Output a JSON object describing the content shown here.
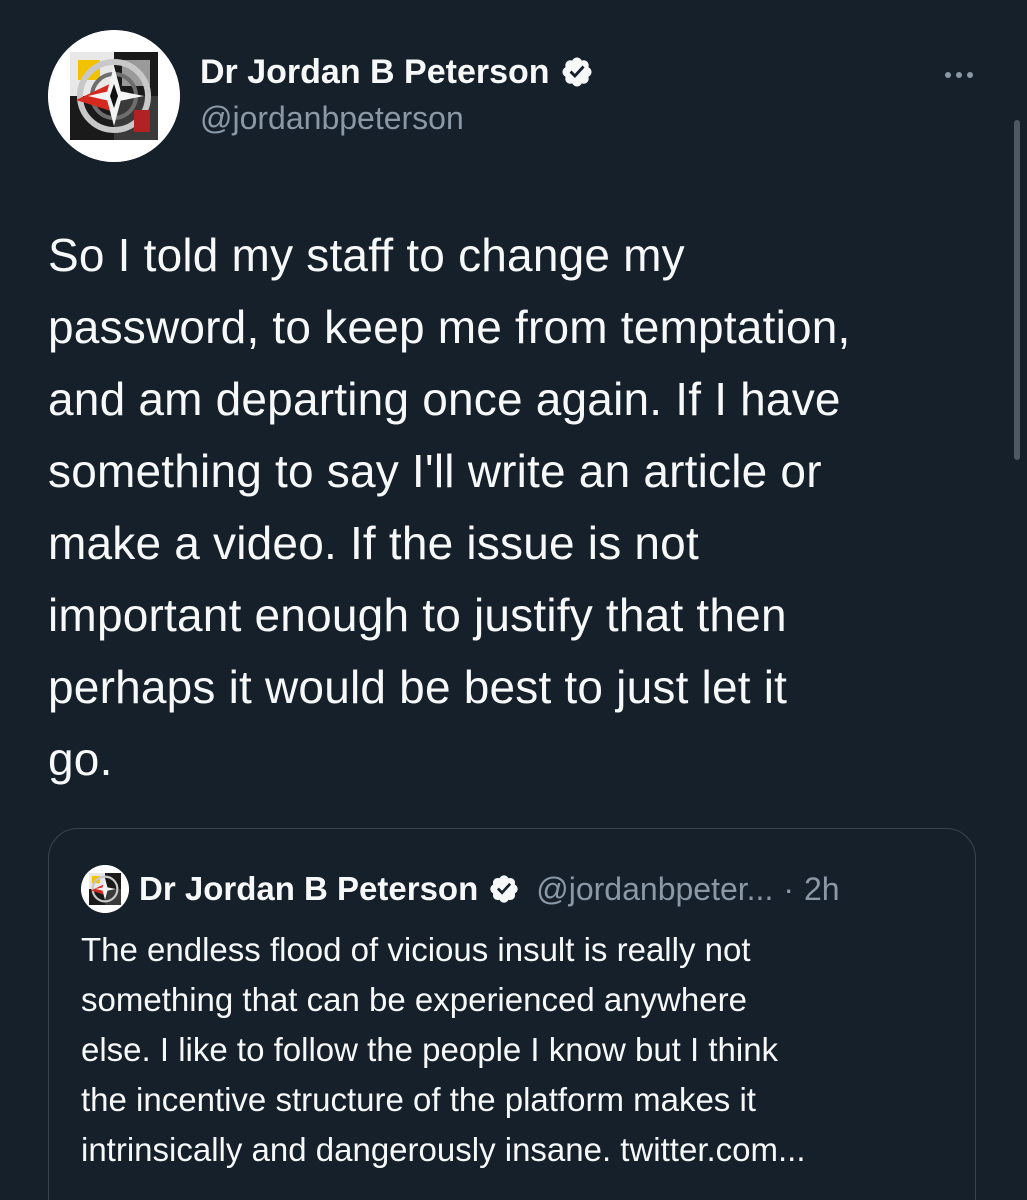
{
  "tweet": {
    "author": {
      "display_name": "Dr Jordan B Peterson",
      "handle": "@jordanbpeterson",
      "avatar_icon": "jbp-logo-icon",
      "verified_icon": "verified-badge-icon"
    },
    "more_icon": "more-options-icon",
    "text": "So I told my staff to change my\npassword, to keep me from temptation,\nand am departing once again. If I have\nsomething to say I'll write an article or\nmake a video. If the issue is not\nimportant enough to justify that then\nperhaps it would be best to just let it\ngo."
  },
  "quote": {
    "display_name": "Dr Jordan B Peterson",
    "handle": "@jordanbpeter...",
    "separator": "·",
    "time": "2h",
    "text": "The endless flood of vicious insult is really not\nsomething that can be experienced anywhere\nelse. I like to follow the people I know but I think\nthe incentive structure of the platform makes it\nintrinsically and dangerously insane. twitter.com..."
  },
  "colors": {
    "background": "#15202b",
    "text_primary": "#f7f9f9",
    "text_secondary": "#8b98a5",
    "border": "#38444d"
  }
}
